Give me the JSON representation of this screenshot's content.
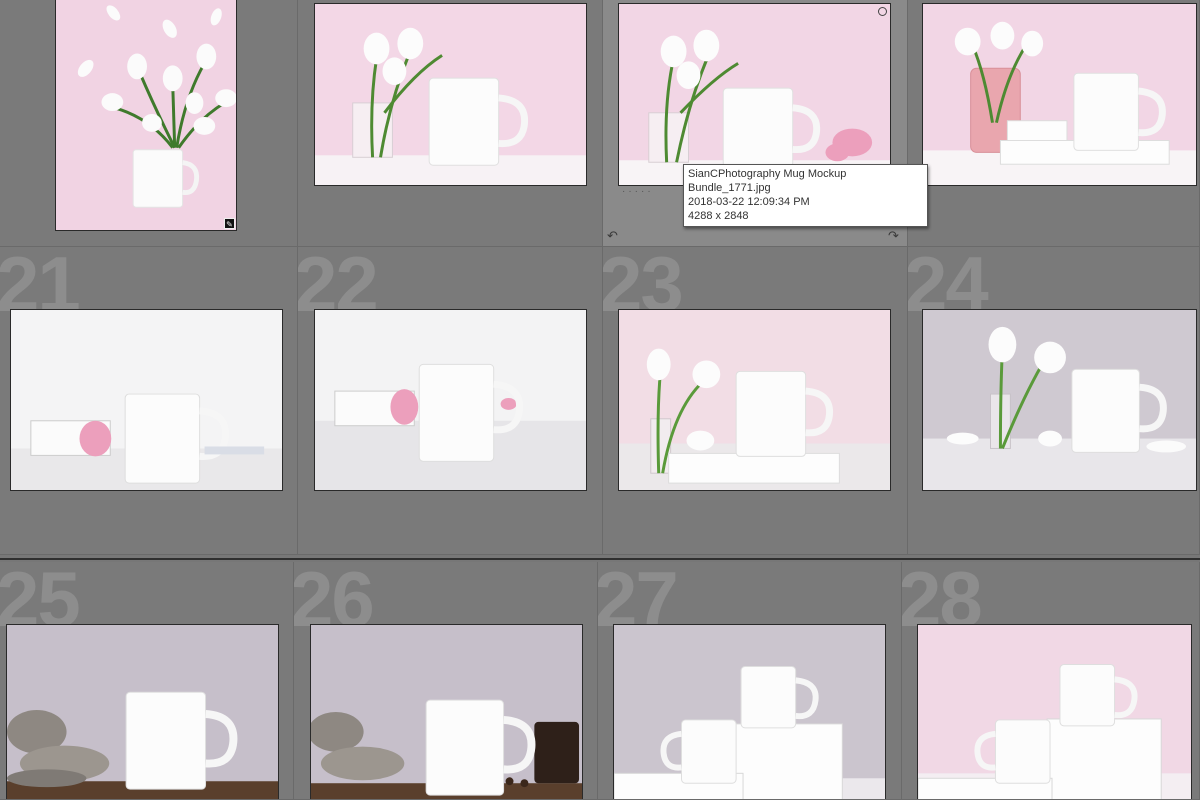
{
  "cells": [
    {
      "num": ""
    },
    {
      "num": ""
    },
    {
      "num": ""
    },
    {
      "num": ""
    },
    {
      "num": "21"
    },
    {
      "num": "22"
    },
    {
      "num": "23"
    },
    {
      "num": "24"
    },
    {
      "num": "25"
    },
    {
      "num": "26"
    },
    {
      "num": "27"
    },
    {
      "num": "28"
    }
  ],
  "tooltip": {
    "filename": "SianCPhotography Mug Mockup Bundle_1771.jpg",
    "datetime": "2018-03-22 12:09:34 PM",
    "dimensions": "4288 x 2848"
  },
  "icons": {
    "edit_badge": "edit-badge-icon",
    "select_circle": "selection-circle-icon",
    "rotate_left": "rotate-left-icon",
    "rotate_right": "rotate-right-icon"
  },
  "colors": {
    "background": "#777777",
    "cell_number": "#8d8d8d",
    "pink_backdrop": "#f2d6e4",
    "lilac_backdrop": "#c9c2cc"
  }
}
